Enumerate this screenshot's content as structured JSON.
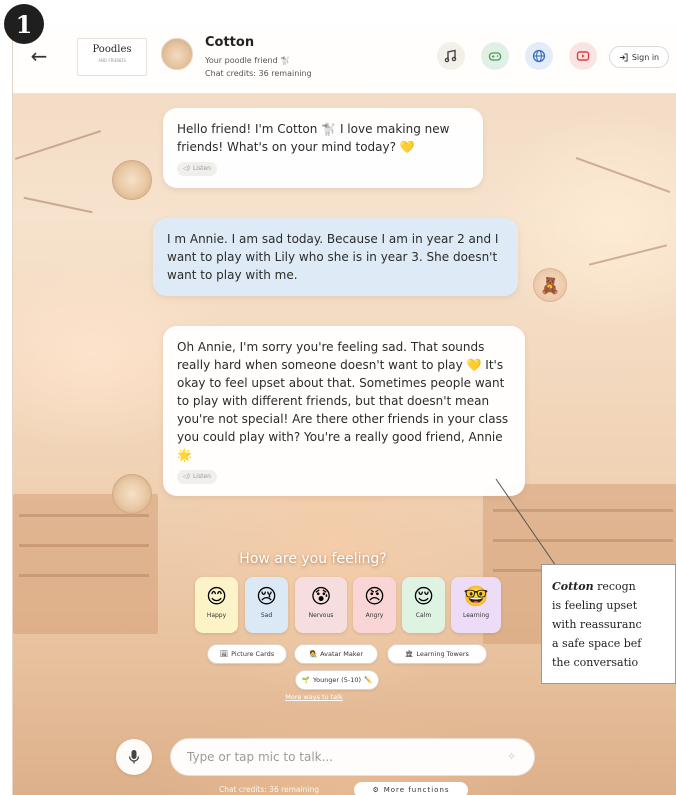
{
  "step_badge": "1",
  "header": {
    "logo_text": "Poodles",
    "logo_subtext": "AND FRIENDS",
    "bot_name": "Cotton",
    "bot_subtitle": "Your poodle friend 🐩",
    "credits_text": "Chat credits: 36 remaining",
    "signin_label": "Sign in",
    "toolbar": [
      {
        "name": "music-icon",
        "color": "#f3efe9",
        "icon_color": "#444444"
      },
      {
        "name": "game-controller-icon",
        "color": "#e1f0e4",
        "icon_color": "#4a9a5a"
      },
      {
        "name": "globe-icon",
        "color": "#e3ecf8",
        "icon_color": "#3d6fbf"
      },
      {
        "name": "video-play-icon",
        "color": "#fbe3e3",
        "icon_color": "#d84343"
      }
    ]
  },
  "messages": [
    {
      "role": "bot",
      "text": "Hello friend! I'm Cotton 🐩 I love making new friends! What's on your mind today? 💛",
      "listen_label": "Listen"
    },
    {
      "role": "user",
      "text": "I m Annie. I am sad today. Because I am in year 2 and I want to play with Lily who she is in year 3. She doesn't want to play with me."
    },
    {
      "role": "bot",
      "text": "Oh Annie, I'm sorry you're feeling sad. That sounds really hard when someone doesn't want to play 💛 It's okay to feel upset about that. Sometimes people want to play with different friends, but that doesn't mean you're not special! Are there other friends in your class you could play with? You're a really good friend, Annie 🌟",
      "listen_label": "Listen"
    }
  ],
  "feelings": {
    "title": "How are you feeling?",
    "items": [
      {
        "label": "Happy",
        "emoji": "😊",
        "color": "#fdf3c9"
      },
      {
        "label": "Sad",
        "emoji": "😢",
        "color": "#dbe9f7"
      },
      {
        "label": "Nervous",
        "emoji": "😰",
        "color": "#f7dede"
      },
      {
        "label": "Angry",
        "emoji": "😠",
        "color": "#fad5d5"
      },
      {
        "label": "Calm",
        "emoji": "😌",
        "color": "#dff3e3"
      },
      {
        "label": "Learning",
        "emoji": "🤓",
        "color": "#ecdcf8"
      }
    ]
  },
  "actions": {
    "picture_cards": "Picture Cards",
    "avatar_maker": "Avatar Maker",
    "learning_towers": "Learning Towers",
    "age_group": "Younger (5-10)",
    "more_ways": "More ways to talk"
  },
  "input": {
    "placeholder": "Type or tap mic to talk..."
  },
  "footer": {
    "credits_text": "Chat credits: 36 remaining",
    "more_functions_label": "More functions"
  },
  "callout": {
    "bold_name": "Cotton",
    "line1_rest": " recogn",
    "line2": "is feeling upset",
    "line3": "with reassuranc",
    "line4": "a safe space bef",
    "line5": "the conversatio"
  }
}
